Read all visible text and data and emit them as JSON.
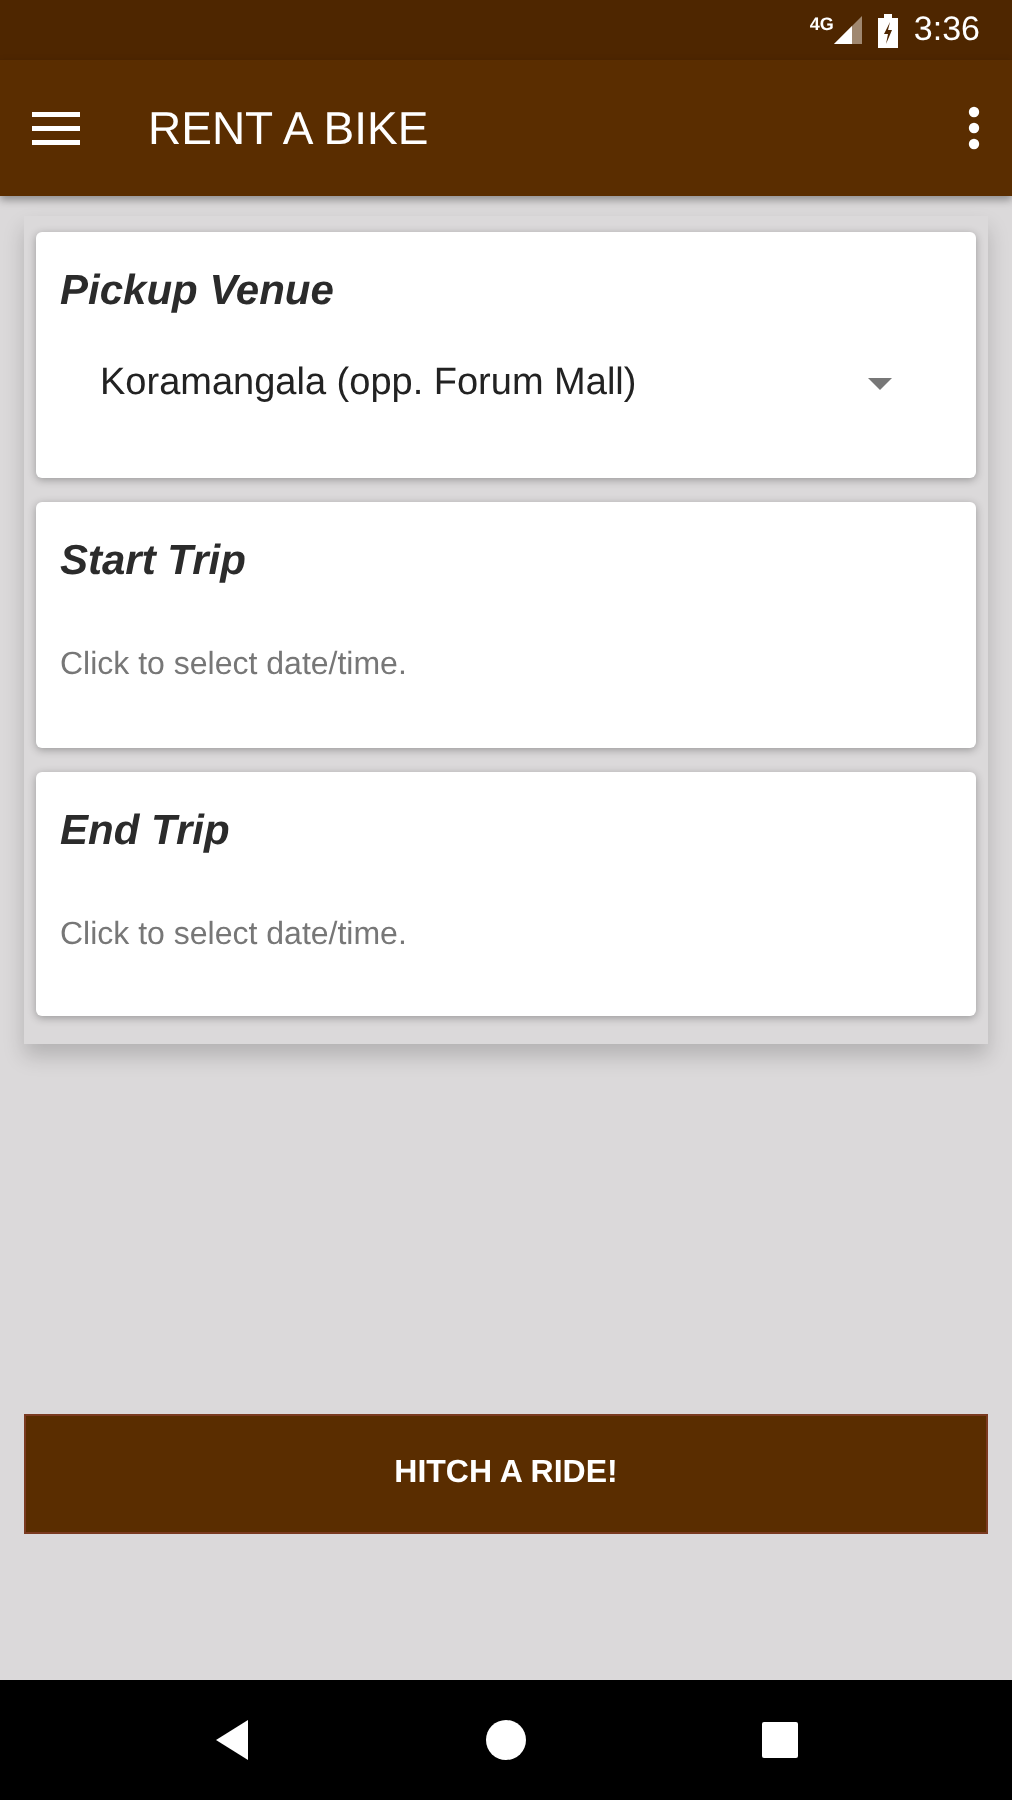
{
  "status_bar": {
    "network": "4G",
    "time": "3:36"
  },
  "app_bar": {
    "title": "RENT A BIKE"
  },
  "cards": [
    {
      "kind": "select",
      "title": "Pickup Venue",
      "value": "Koramangala (opp. Forum Mall)"
    },
    {
      "kind": "datetime",
      "title": "Start Trip",
      "placeholder": "Click to select date/time."
    },
    {
      "kind": "datetime",
      "title": "End Trip",
      "placeholder": "Click to select date/time."
    }
  ],
  "action_button": {
    "label": "HITCH A RIDE!"
  }
}
